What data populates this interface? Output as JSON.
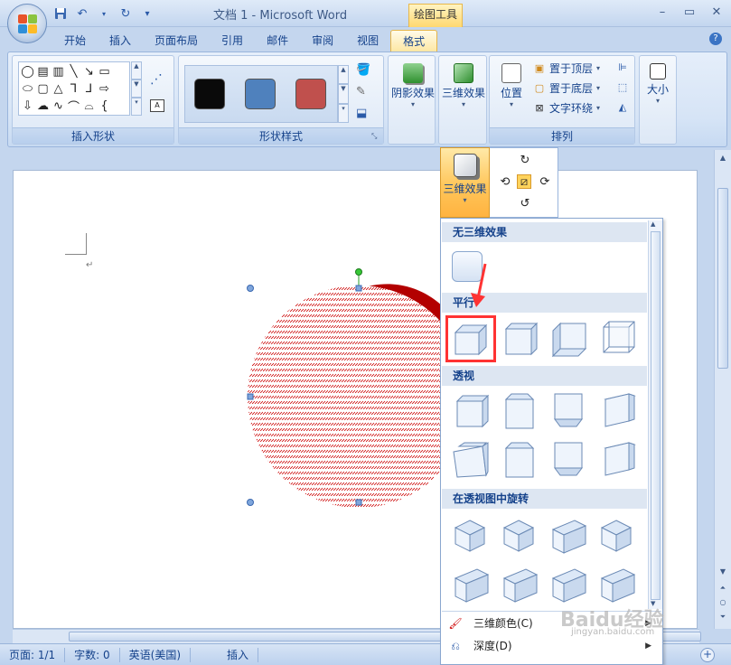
{
  "window": {
    "title": "文档 1 - Microsoft Word",
    "context_tab_group": "绘图工具"
  },
  "quick_access": [
    "save-icon",
    "undo-icon",
    "redo-icon",
    "customize-icon"
  ],
  "tabs": [
    {
      "label": "开始",
      "active": false
    },
    {
      "label": "插入",
      "active": false
    },
    {
      "label": "页面布局",
      "active": false
    },
    {
      "label": "引用",
      "active": false
    },
    {
      "label": "邮件",
      "active": false
    },
    {
      "label": "审阅",
      "active": false
    },
    {
      "label": "视图",
      "active": false
    },
    {
      "label": "格式",
      "active": true
    }
  ],
  "ribbon": {
    "insert_shapes": {
      "label": "插入形状"
    },
    "shape_styles": {
      "label": "形状样式",
      "swatches": [
        "#0a0a0a",
        "#4f81bd",
        "#c0504d"
      ]
    },
    "shadow_effects": {
      "label": "阴影效果"
    },
    "effects_3d": {
      "label": "三维效果"
    },
    "arrange": {
      "label": "排列",
      "position": "位置",
      "bring_front": "置于顶层",
      "send_back": "置于底层",
      "text_wrap": "文字环绕"
    },
    "size": {
      "label": "大小"
    }
  },
  "dropdown": {
    "hover_button": "三维效果",
    "sections": {
      "none": "无三维效果",
      "parallel": "平行",
      "perspective": "透视",
      "rotate": "在透视图中旋转"
    },
    "menu_items": [
      {
        "label": "三维颜色(C)",
        "icon": "color-fill-icon"
      },
      {
        "label": "深度(D)",
        "icon": "depth-icon"
      }
    ]
  },
  "colors": {
    "shape_fill": "#b30000",
    "highlight": "#ff3333",
    "menu_header": "#dde6f2"
  },
  "status_bar": {
    "page": "页面: 1/1",
    "words": "字数: 0",
    "language": "英语(美国)",
    "mode": "插入"
  },
  "watermark": {
    "text": "Baidu经验",
    "url": "jingyan.baidu.com"
  }
}
